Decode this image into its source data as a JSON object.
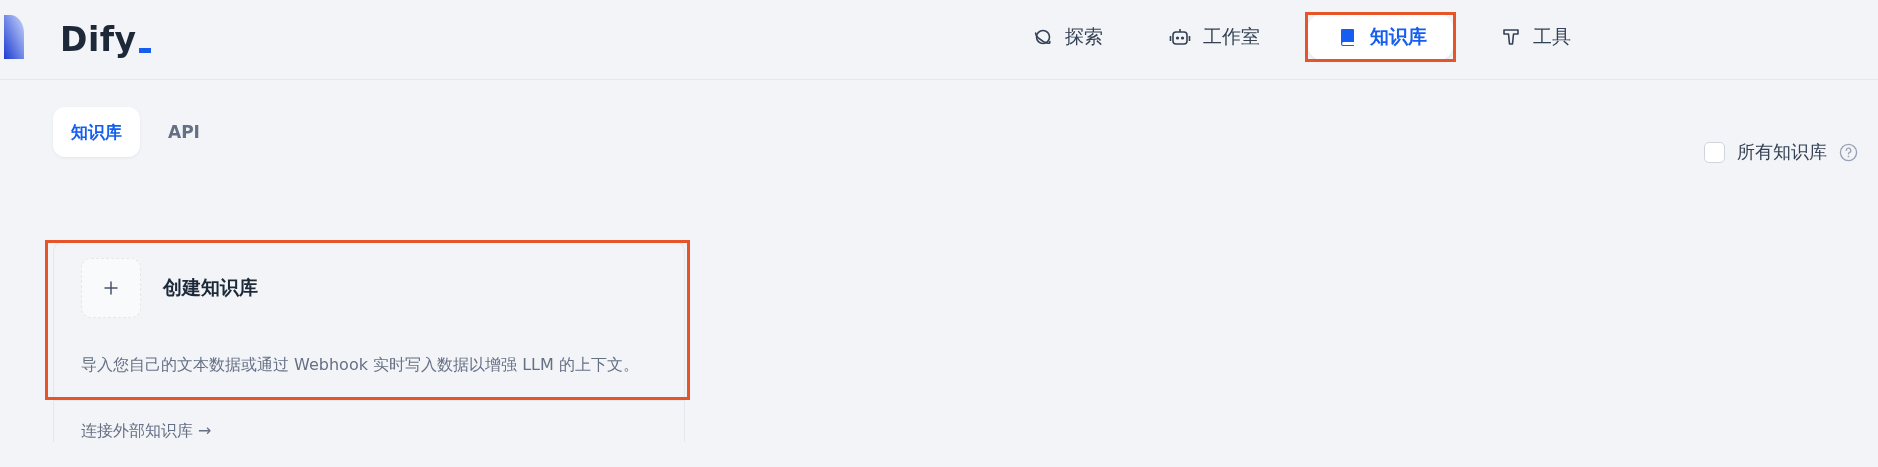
{
  "logo": {
    "text": "Dify"
  },
  "nav": [
    {
      "label": "探索",
      "selected": false,
      "highlighted": false
    },
    {
      "label": "工作室",
      "selected": false,
      "highlighted": false
    },
    {
      "label": "知识库",
      "selected": true,
      "highlighted": true
    },
    {
      "label": "工具",
      "selected": false,
      "highlighted": false
    }
  ],
  "tabs": [
    {
      "label": "知识库",
      "selected": true
    },
    {
      "label": "API",
      "selected": false
    }
  ],
  "filter": {
    "label": "所有知识库",
    "checked": false
  },
  "create_card": {
    "title": "创建知识库",
    "description": "导入您自己的文本数据或通过 Webhook 实时写入数据以增强 LLM 的上下文。",
    "highlighted": true,
    "link": "连接外部知识库 →"
  }
}
